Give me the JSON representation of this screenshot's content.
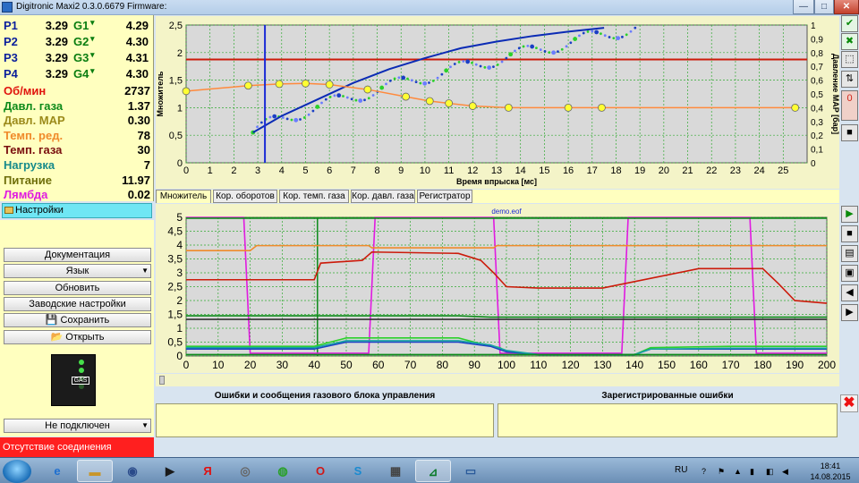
{
  "window": {
    "title": "Digitronic Maxi2 0.3.0.6679 Firmware:"
  },
  "readouts": {
    "pressures": [
      {
        "p_label": "P1",
        "p_value": "3.29",
        "g_label": "G1",
        "g_value": "4.29"
      },
      {
        "p_label": "P2",
        "p_value": "3.29",
        "g_label": "G2",
        "g_value": "4.30"
      },
      {
        "p_label": "P3",
        "p_value": "3.29",
        "g_label": "G3",
        "g_value": "4.31"
      },
      {
        "p_label": "P4",
        "p_value": "3.29",
        "g_label": "G4",
        "g_value": "4.30"
      }
    ],
    "metrics": [
      {
        "label": "Об/мин",
        "value": "2737",
        "color": "#e0140d"
      },
      {
        "label": "Давл. газа",
        "value": "1.37",
        "color": "#0d8a1a"
      },
      {
        "label": "Давл. MAP",
        "value": "0.30",
        "color": "#9b8a1a"
      },
      {
        "label": "Темп. ред.",
        "value": "78",
        "color": "#f08a2a"
      },
      {
        "label": "Темп. газа",
        "value": "30",
        "color": "#7a0f0f"
      },
      {
        "label": "Нагрузка",
        "value": "7",
        "color": "#168a8a"
      },
      {
        "label": "Питание",
        "value": "11.97",
        "color": "#6e6e0a"
      },
      {
        "label": "Лямбда",
        "value": "0.02",
        "color": "#e01be0"
      }
    ]
  },
  "settings": {
    "header": "Настройки",
    "buttons": {
      "documentation": "Документация",
      "language": "Язык",
      "update": "Обновить",
      "factory": "Заводские настройки",
      "save": "Сохранить",
      "open": "Открыть"
    },
    "connection": "Не подключен",
    "status": "Отсутствие соединения",
    "gas_label": "GAS"
  },
  "tabs": [
    {
      "label": "Множитель",
      "active": true
    },
    {
      "label": "Кор. оборотов",
      "active": false
    },
    {
      "label": "Кор. темп. газа",
      "active": false
    },
    {
      "label": "Кор. давл. газа",
      "active": false
    },
    {
      "label": "Регистратор",
      "active": false
    }
  ],
  "chart_data": [
    {
      "type": "scatter",
      "xlabel": "Время впрыска [мс]",
      "ylabel": "Множитель",
      "y2label": "Давление MAP [бар]",
      "xlim": [
        0,
        26
      ],
      "ylim": [
        0,
        2.5
      ],
      "y2lim": [
        0,
        1
      ],
      "xticks": [
        0,
        1,
        2,
        3,
        4,
        5,
        6,
        7,
        8,
        9,
        10,
        11,
        12,
        13,
        14,
        15,
        16,
        17,
        18,
        19,
        20,
        21,
        22,
        23,
        24,
        25
      ],
      "yticks": [
        0,
        0.5,
        1,
        1.5,
        2,
        2.5
      ],
      "y2ticks": [
        0,
        0.1,
        0.2,
        0.3,
        0.4,
        0.5,
        0.6,
        0.7,
        0.8,
        0.9,
        1
      ],
      "cursor_x": 3.3,
      "series": [
        {
          "kind": "multiplier-curve",
          "color": "#ff8a3c",
          "x": [
            0,
            2.6,
            3.9,
            5,
            6,
            7.6,
            9.2,
            10.2,
            11,
            12,
            13.5,
            16,
            17.4,
            20,
            25.5
          ],
          "y": [
            1.3,
            1.4,
            1.43,
            1.44,
            1.42,
            1.33,
            1.2,
            1.12,
            1.08,
            1.03,
            1.0,
            1.0,
            1.0,
            1.0,
            1.0
          ],
          "markers_x": [
            0,
            2.6,
            3.9,
            5,
            6,
            7.6,
            9.2,
            10.2,
            11,
            12,
            13.5,
            16,
            17.4,
            25.5
          ]
        },
        {
          "kind": "map-threshold",
          "color": "#cc1a0a",
          "y": 0.75
        },
        {
          "kind": "fit-curve",
          "color": "#0b2bb5",
          "x": [
            2.8,
            4,
            5.5,
            7,
            8.5,
            10,
            11.5,
            13,
            14.5,
            16,
            17.5
          ],
          "y": [
            0.55,
            0.85,
            1.15,
            1.45,
            1.7,
            1.9,
            2.08,
            2.2,
            2.3,
            2.38,
            2.45
          ]
        }
      ]
    },
    {
      "type": "line",
      "title": "demo.eof",
      "xlim": [
        0,
        200
      ],
      "ylim": [
        0,
        5
      ],
      "xticks": [
        0,
        10,
        20,
        30,
        40,
        50,
        60,
        70,
        80,
        90,
        100,
        110,
        120,
        130,
        140,
        150,
        160,
        170,
        180,
        190,
        200
      ],
      "yticks": [
        0,
        0.5,
        1,
        1.5,
        2,
        2.5,
        3,
        3.5,
        4,
        4.5,
        5
      ],
      "series": [
        {
          "color": "#e01be0",
          "x": [
            0,
            18,
            20,
            57,
            59,
            96,
            98,
            136,
            138,
            176,
            178,
            200
          ],
          "y": [
            5,
            5,
            0.1,
            0.1,
            5,
            5,
            0.1,
            0.1,
            5,
            5,
            0.1,
            0.1
          ]
        },
        {
          "color": "#cc1a0a",
          "x": [
            0,
            40,
            42,
            55,
            58,
            85,
            92,
            96,
            100,
            110,
            130,
            160,
            165,
            180,
            185,
            190,
            200
          ],
          "y": [
            2.75,
            2.75,
            3.35,
            3.45,
            3.75,
            3.7,
            3.45,
            3.0,
            2.5,
            2.45,
            2.45,
            3.15,
            3.15,
            3.15,
            2.6,
            2.0,
            1.9
          ]
        },
        {
          "color": "#f08a2a",
          "x": [
            0,
            20,
            22,
            57,
            58,
            96,
            97,
            200
          ],
          "y": [
            3.8,
            3.8,
            3.98,
            3.98,
            3.9,
            3.9,
            3.98,
            3.98
          ]
        },
        {
          "color": "#0d8a1a",
          "x": [
            0,
            200
          ],
          "y": [
            4.97,
            4.97
          ]
        },
        {
          "color": "#0d8a1a",
          "x": [
            0,
            60,
            85,
            95,
            200
          ],
          "y": [
            1.45,
            1.45,
            1.45,
            1.4,
            1.4
          ]
        },
        {
          "color": "#333333",
          "x": [
            0,
            200
          ],
          "y": [
            1.32,
            1.32
          ]
        },
        {
          "color": "#2bd12b",
          "x": [
            0,
            40,
            50,
            85,
            90,
            98,
            100,
            110,
            140,
            145,
            170,
            200
          ],
          "y": [
            0.35,
            0.35,
            0.65,
            0.65,
            0.5,
            0.3,
            0.15,
            0.05,
            0.05,
            0.3,
            0.35,
            0.35
          ]
        },
        {
          "color": "#1b3fc5",
          "x": [
            0,
            40,
            50,
            85,
            95,
            100,
            110,
            140,
            145,
            170,
            200
          ],
          "y": [
            0.25,
            0.25,
            0.5,
            0.5,
            0.35,
            0.15,
            0.05,
            0.05,
            0.25,
            0.25,
            0.25
          ]
        },
        {
          "color": "#17a3a3",
          "x": [
            0,
            40,
            50,
            85,
            95,
            100,
            110,
            140,
            145,
            170,
            200
          ],
          "y": [
            0.3,
            0.3,
            0.55,
            0.55,
            0.4,
            0.2,
            0.05,
            0.05,
            0.25,
            0.28,
            0.28
          ]
        },
        {
          "color": "#0d8a1a",
          "x": [
            0,
            200
          ],
          "y": [
            0.05,
            0.05
          ]
        }
      ],
      "vmarkers": [
        {
          "color": "#0d8a1a",
          "x": 41
        }
      ]
    }
  ],
  "errors": {
    "left_title": "Ошибки и сообщения газового блока управления",
    "right_title": "Зарегистрированные ошибки"
  },
  "taskbar": {
    "lang": "RU",
    "time": "18:41",
    "date": "14.08.2015"
  }
}
